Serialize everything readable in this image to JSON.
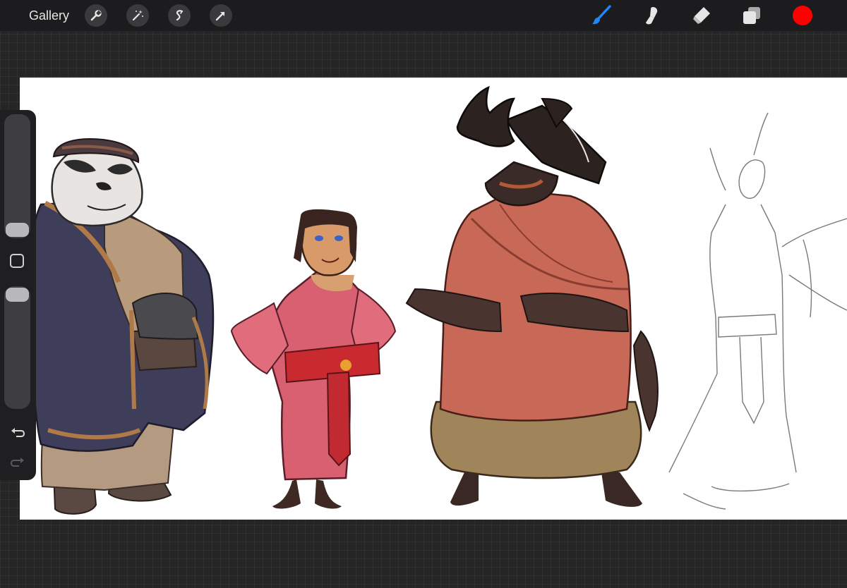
{
  "toolbar": {
    "gallery_label": "Gallery",
    "left_tools": [
      "wrench-icon",
      "magic-wand-icon",
      "selection-icon",
      "transform-arrow-icon"
    ],
    "right_tools": [
      "brush-icon",
      "smudge-icon",
      "eraser-icon",
      "layers-icon"
    ],
    "active_tool": "brush-icon",
    "active_tool_color": "#1e88ff",
    "current_color": "#ff0000"
  },
  "sidebar": {
    "brush_size_level": 0.0,
    "opacity_level": 1.0,
    "buttons": [
      "modify-icon",
      "undo-icon",
      "redo-icon"
    ]
  },
  "canvas": {
    "background": "#ffffff",
    "content": [
      "bear-character-figure",
      "woman-character-figure",
      "beetle-character-figure",
      "sketch-character-figure"
    ]
  },
  "colors": {
    "toolbar_bg": "#1c1c1e",
    "workspace_bg": "#252526",
    "sidebar_bg": "#1f1f21"
  }
}
